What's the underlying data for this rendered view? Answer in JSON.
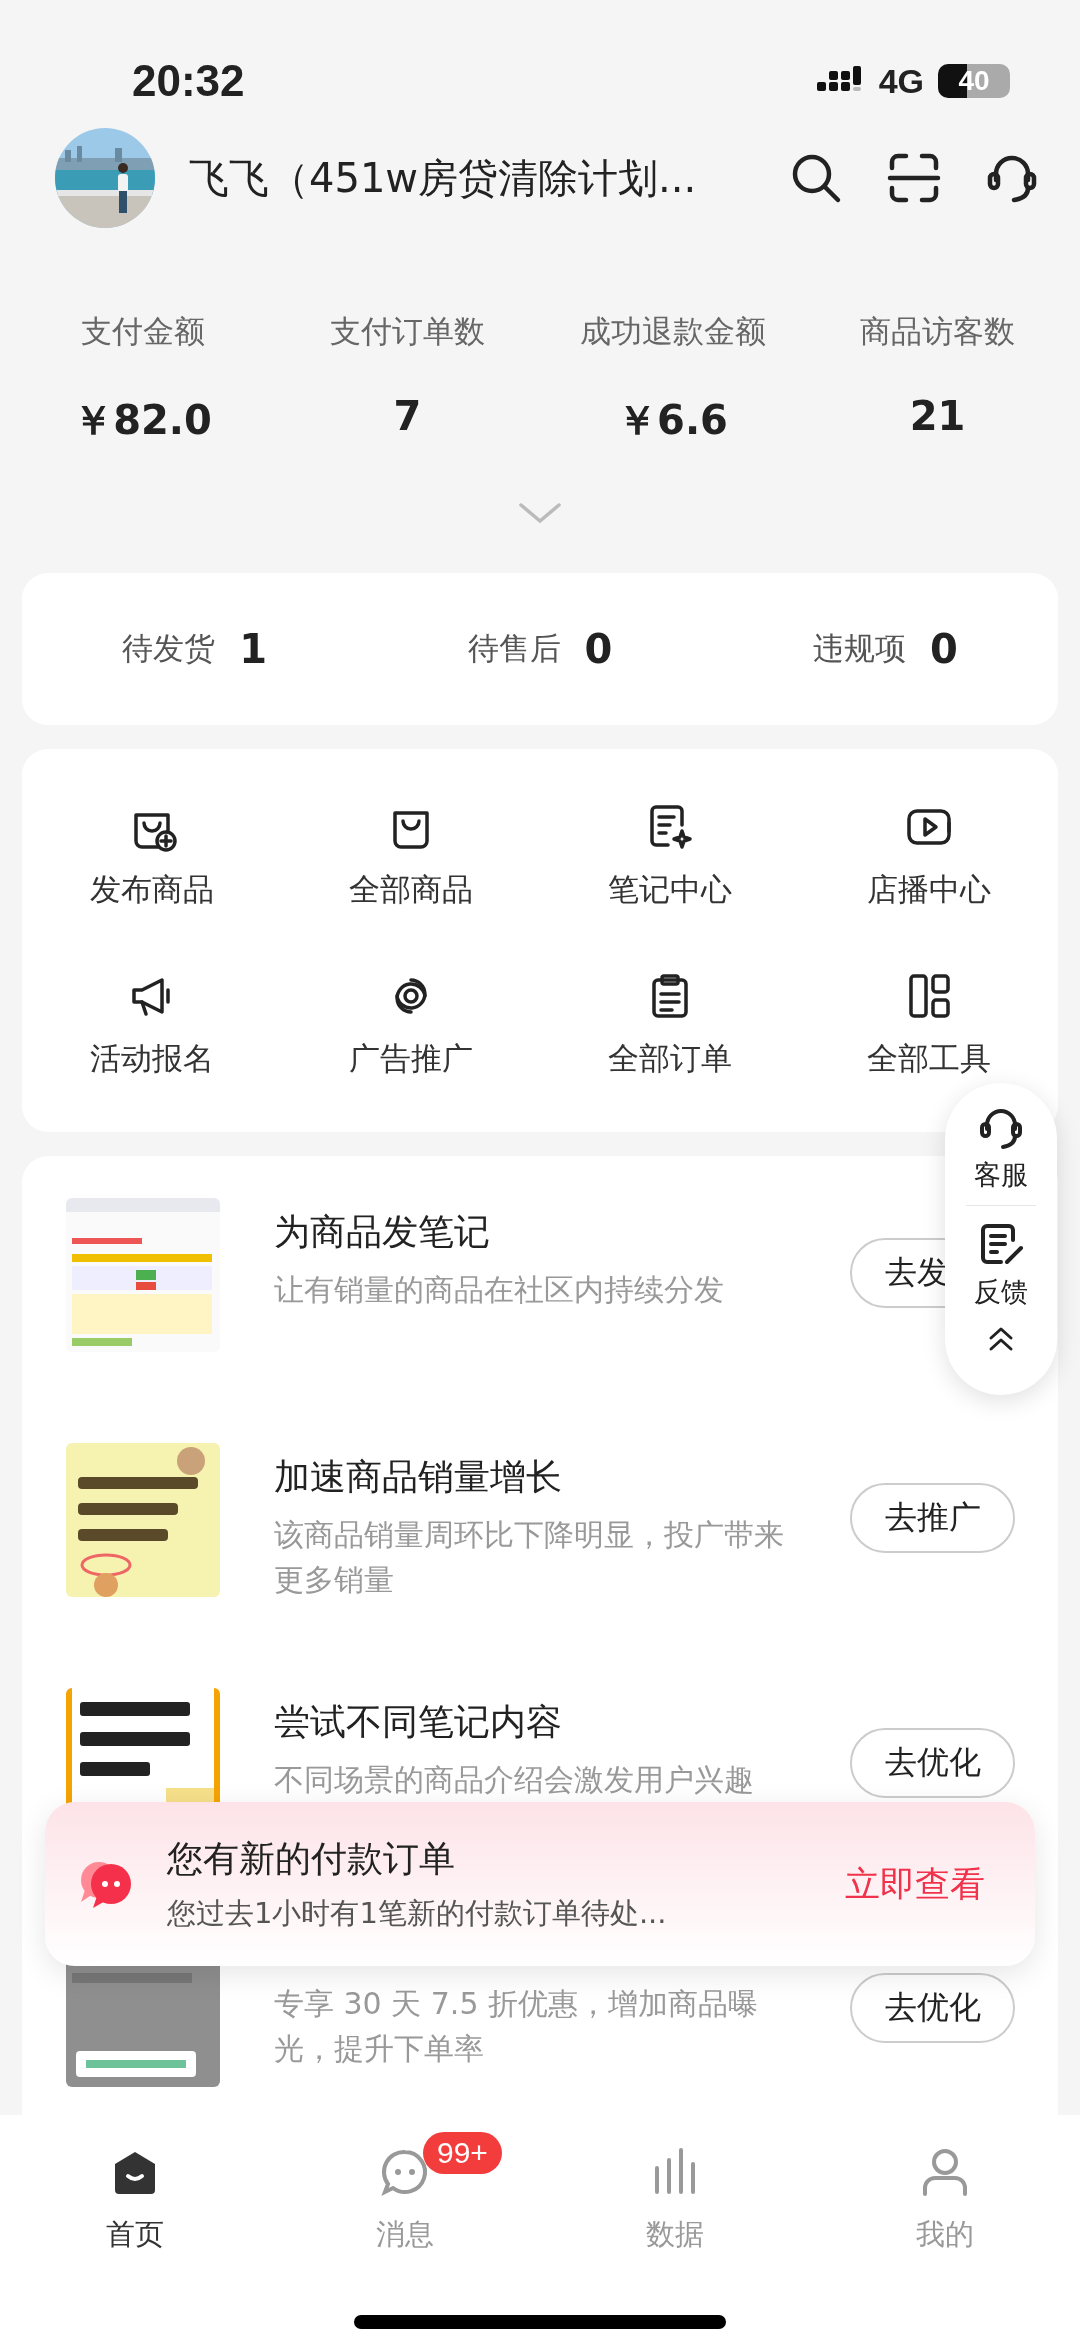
{
  "status_bar": {
    "time": "20:32",
    "network": "4G",
    "battery": "40"
  },
  "header": {
    "shop_name": "飞飞（451w房贷清除计划..."
  },
  "stats": [
    {
      "label": "支付金额",
      "value": "￥82.0"
    },
    {
      "label": "支付订单数",
      "value": "7"
    },
    {
      "label": "成功退款金额",
      "value": "￥6.6"
    },
    {
      "label": "商品访客数",
      "value": "21"
    }
  ],
  "todo": [
    {
      "label": "待发货",
      "count": "1"
    },
    {
      "label": "待售后",
      "count": "0"
    },
    {
      "label": "违规项",
      "count": "0"
    }
  ],
  "tools": [
    {
      "label": "发布商品"
    },
    {
      "label": "全部商品"
    },
    {
      "label": "笔记中心"
    },
    {
      "label": "店播中心"
    },
    {
      "label": "活动报名"
    },
    {
      "label": "广告推广"
    },
    {
      "label": "全部订单"
    },
    {
      "label": "全部工具"
    }
  ],
  "tasks": [
    {
      "title": "为商品发笔记",
      "description": "让有销量的商品在社区内持续分发",
      "button": "去发"
    },
    {
      "title": "加速商品销量增长",
      "description": "该商品销量周环比下降明显，投广带来更多销量",
      "button": "去推广"
    },
    {
      "title": "尝试不同笔记内容",
      "description": "不同场景的商品介绍会激发用户兴趣",
      "button": "去优化"
    },
    {
      "description": "专享 30 天 7.5 折优惠，增加商品曝光，提升下单率",
      "button": "去优化"
    }
  ],
  "side_panel": [
    {
      "label": "客服"
    },
    {
      "label": "反馈"
    }
  ],
  "toast": {
    "title": "您有新的付款订单",
    "message": "您过去1小时有1笔新的付款订单待处...",
    "action": "立即查看"
  },
  "tab_bar": [
    {
      "label": "首页",
      "selected": true
    },
    {
      "label": "消息",
      "selected": false,
      "badge": "99+"
    },
    {
      "label": "数据",
      "selected": false
    },
    {
      "label": "我的",
      "selected": false
    }
  ]
}
